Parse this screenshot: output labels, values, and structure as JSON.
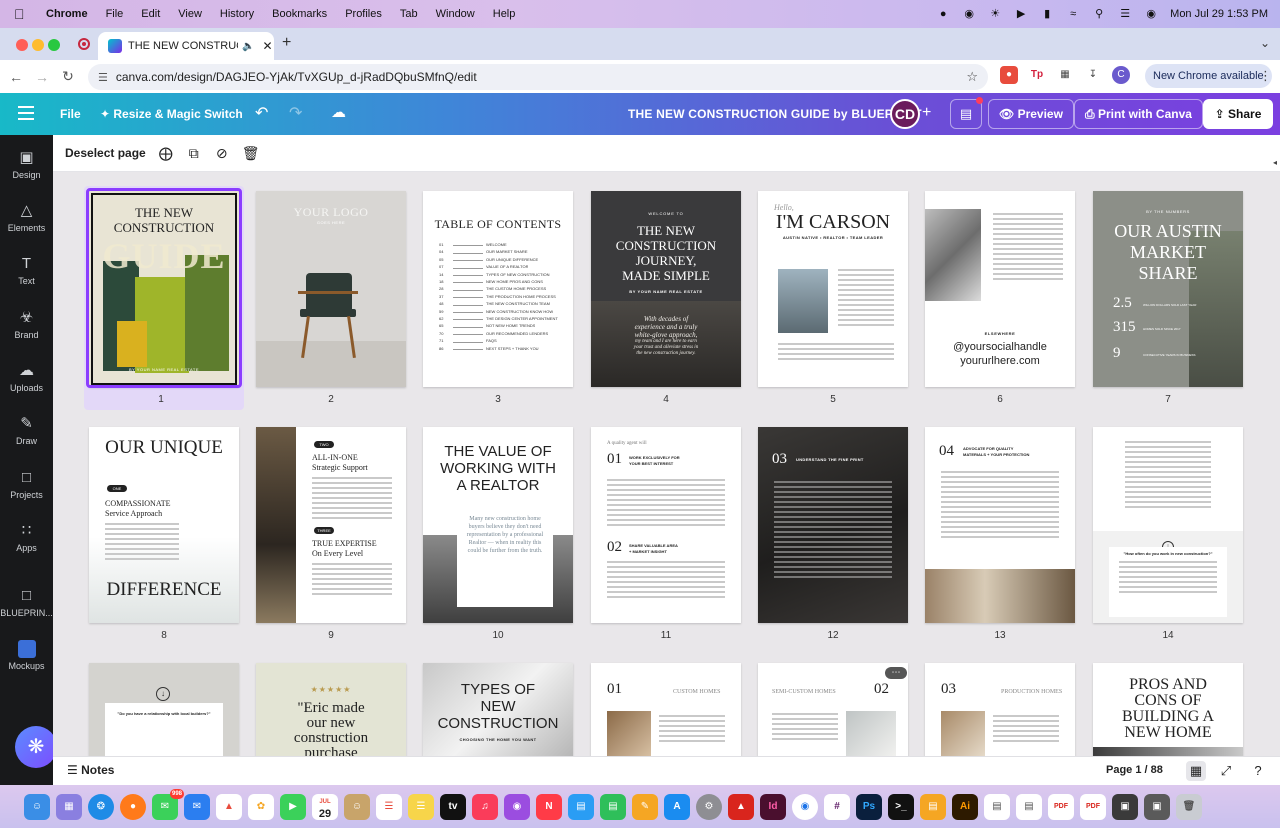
{
  "menubar": {
    "app": "Chrome",
    "items": [
      "File",
      "Edit",
      "View",
      "History",
      "Bookmarks",
      "Profiles",
      "Tab",
      "Window",
      "Help"
    ],
    "datetime": "Mon Jul 29  1:53 PM"
  },
  "browser": {
    "tab_title": "THE NEW CONSTRUCTIO",
    "url": "canva.com/design/DAGJEO-YjAk/TvXGUp_d-jRadDQbuSMfnQ/edit",
    "new_chrome": "New Chrome available"
  },
  "canva": {
    "file": "File",
    "resize": "Resize & Magic Switch",
    "title": "THE NEW CONSTRUCTION GUIDE by BLUEPRINT",
    "avatar": "CD",
    "preview": "Preview",
    "print": "Print with Canva",
    "share": "Share"
  },
  "rail": {
    "design": "Design",
    "elements": "Elements",
    "text": "Text",
    "brand": "Brand",
    "uploads": "Uploads",
    "draw": "Draw",
    "projects": "Projects",
    "apps": "Apps",
    "blueprint": "BLUEPRIN...",
    "mockups": "Mockups"
  },
  "toolbar": {
    "deselect": "Deselect page"
  },
  "pages": {
    "n1": "1",
    "n2": "2",
    "n3": "3",
    "n4": "4",
    "n5": "5",
    "n6": "6",
    "n7": "7",
    "n8": "8",
    "n9": "9",
    "n10": "10",
    "n11": "11",
    "n12": "12",
    "n13": "13",
    "n14": "14",
    "p1": {
      "l1": "THE NEW",
      "l2": "CONSTRUCTION",
      "l3": "GUIDE",
      "foot": "BY YOUR NAME REAL ESTATE"
    },
    "p2": {
      "l1": "YOUR LOGO",
      "l2": "GOES HERE"
    },
    "p3": {
      "l1": "TABLE OF CONTENTS",
      "entries": [
        {
          "n": "01",
          "t": "WELCOME"
        },
        {
          "n": "04",
          "t": "OUR MARKET SHARE"
        },
        {
          "n": "05",
          "t": "OUR UNIQUE DIFFERENCE"
        },
        {
          "n": "07",
          "t": "VALUE OF A REALTOR"
        },
        {
          "n": "14",
          "t": "TYPES OF NEW CONSTRUCTION"
        },
        {
          "n": "18",
          "t": "NEW HOME PROS AND CONS"
        },
        {
          "n": "28",
          "t": "THE CUSTOM HOME PROCESS"
        },
        {
          "n": "37",
          "t": "THE PRODUCTION HOME PROCESS"
        },
        {
          "n": "48",
          "t": "THE NEW CONSTRUCTION TEAM"
        },
        {
          "n": "59",
          "t": "NEW CONSTRUCTION KNOW HOW"
        },
        {
          "n": "62",
          "t": "THE DESIGN CENTER APPOINTMENT"
        },
        {
          "n": "65",
          "t": "NOT NEW HOME TRENDS"
        },
        {
          "n": "70",
          "t": "OUR RECOMMENDED LENDERS"
        },
        {
          "n": "71",
          "t": "FAQS"
        },
        {
          "n": "86",
          "t": "NEXT STEPS + THANK YOU"
        }
      ]
    },
    "p4": {
      "top": "WELCOME TO",
      "l1": "THE NEW",
      "l2": "CONSTRUCTION",
      "l3": "JOURNEY,",
      "l4": "MADE SIMPLE",
      "by": "BY YOUR NAME REAL ESTATE",
      "q1": "With decades of",
      "q2": "experience and a truly",
      "q3": "white-glove approach,",
      "q4": "my team and I are here to earn",
      "q5": "your trust and alleviate stress in",
      "q6": "the new construction journey."
    },
    "p5": {
      "hello": "Hello,",
      "l1": "I'M CARSON",
      "sub": "AUSTIN NATIVE • REALTOR • TEAM LEADER"
    },
    "p6": {
      "handle": "@yoursocialhandle",
      "url": "yoururlhere.com",
      "else": "ELSEWHERE"
    },
    "p7": {
      "top": "BY THE NUMBERS",
      "l1": "OUR AUSTIN",
      "l2": "MARKET",
      "l3": "SHARE",
      "s1": "2.5",
      "s1l": "WILLION DOLLARS SOLD LAST YEAR",
      "s2": "315",
      "s2l": "HOMES SOLD SINCE 2017",
      "s3": "9",
      "s3l": "CONSECUTIVE YEARS IN BUSINESS"
    },
    "p8": {
      "l1": "OUR UNIQUE",
      "badge": "ONE",
      "h1": "COMPASSIONATE",
      "h2": "Service Approach",
      "l2": "DIFFERENCE"
    },
    "p9": {
      "b1": "TWO",
      "h1": "ALL-IN-ONE",
      "h2": "Strategic Support",
      "b2": "THREE",
      "h3": "TRUE EXPERTISE",
      "h4": "On Every Level"
    },
    "p10": {
      "l1": "THE VALUE OF",
      "l2": "WORKING WITH",
      "l3": "A REALTOR",
      "q1": "Many new construction home",
      "q2": "buyers believe they don't need",
      "q3": "representation by a professional",
      "q4": "Realtor — when in reality this",
      "q5": "could be further from the truth."
    },
    "p11": {
      "top": "A quality agent will",
      "n1": "01",
      "h1a": "WORK EXCLUSIVELY FOR",
      "h1b": "YOUR BEST INTEREST",
      "n2": "02",
      "h2a": "SHARE VALUABLE AREA",
      "h2b": "+ MARKET INSIGHT"
    },
    "p12": {
      "n": "03",
      "h": "UNDERSTAND THE FINE PRINT"
    },
    "p13": {
      "n": "04",
      "h1": "ADVOCATE FOR QUALITY",
      "h2": "MATERIALS + YOUR PROTECTION"
    },
    "p14": {
      "q": "\"How often do you work in new construction?\""
    }
  },
  "row3": {
    "a": "\"Do you have a relationship with local builders?\"",
    "b1": "\"Eric made",
    "b2": "our new",
    "b3": "construction",
    "b4": "purchase",
    "c1": "TYPES OF",
    "c2": "NEW",
    "c3": "CONSTRUCTION",
    "c4": "CHOOSING THE HOME YOU WANT",
    "d1": "01",
    "d2": "CUSTOM HOMES",
    "e1": "SEMI-CUSTOM HOMES",
    "e2": "02",
    "f1": "03",
    "f2": "PRODUCTION HOMES",
    "g1": "PROS AND",
    "g2": "CONS OF",
    "g3": "BUILDING A",
    "g4": "NEW HOME"
  },
  "bottom": {
    "notes": "Notes",
    "page_count": "Page 1 / 88"
  },
  "dock": {
    "cal_month": "JUL",
    "cal_day": "29",
    "badge": "998"
  }
}
